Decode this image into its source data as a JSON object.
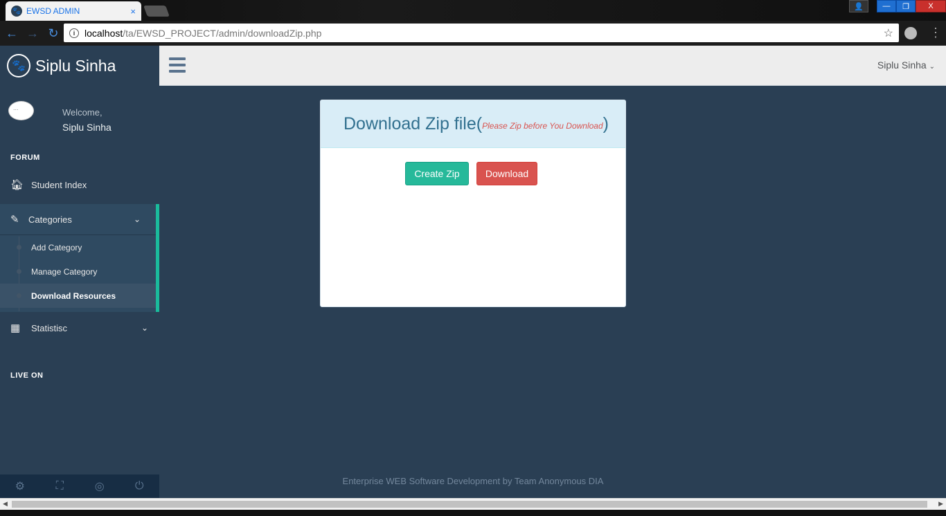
{
  "browser": {
    "tab_title": "EWSD ADMIN",
    "tab_close": "×",
    "url_host": "localhost",
    "url_path": "/ta/EWSD_PROJECT/admin/downloadZip.php",
    "info_glyph": "i",
    "star_glyph": "☆",
    "back_glyph": "←",
    "forward_glyph": "→",
    "reload_glyph": "↻",
    "min_glyph": "—",
    "max_glyph": "❐",
    "close_glyph": "X",
    "menu_glyph": "⋮"
  },
  "sidebar": {
    "brand": "Siplu Sinha",
    "profile_img_alt": "...",
    "welcome": "Welcome,",
    "user_name": "Siplu Sinha",
    "section_forum": "FORUM",
    "student_index": "Student Index",
    "categories": "Categories",
    "sub_items": [
      {
        "label": "Add Category"
      },
      {
        "label": "Manage Category"
      },
      {
        "label": "Download Resources"
      }
    ],
    "statistics": "Statistisc",
    "section_live": "LIVE ON",
    "footer_icons": [
      "gear-icon",
      "fullscreen-icon",
      "eye-slash-icon",
      "power-icon"
    ]
  },
  "topnav": {
    "user_menu": "Siplu Sinha"
  },
  "panel": {
    "title": "Download Zip file",
    "paren_open": "(",
    "paren_close": ")",
    "warning": "Please Zip before You Download",
    "create_zip": "Create Zip",
    "download": "Download"
  },
  "footer": {
    "text": "Enterprise WEB Software Development by Team Anonymous DIA"
  },
  "colors": {
    "sidebar_bg": "#2a3f54",
    "accent": "#1abb9c",
    "create_btn": "#26b99a",
    "download_btn": "#d9534f",
    "panel_head": "#d9edf7"
  }
}
